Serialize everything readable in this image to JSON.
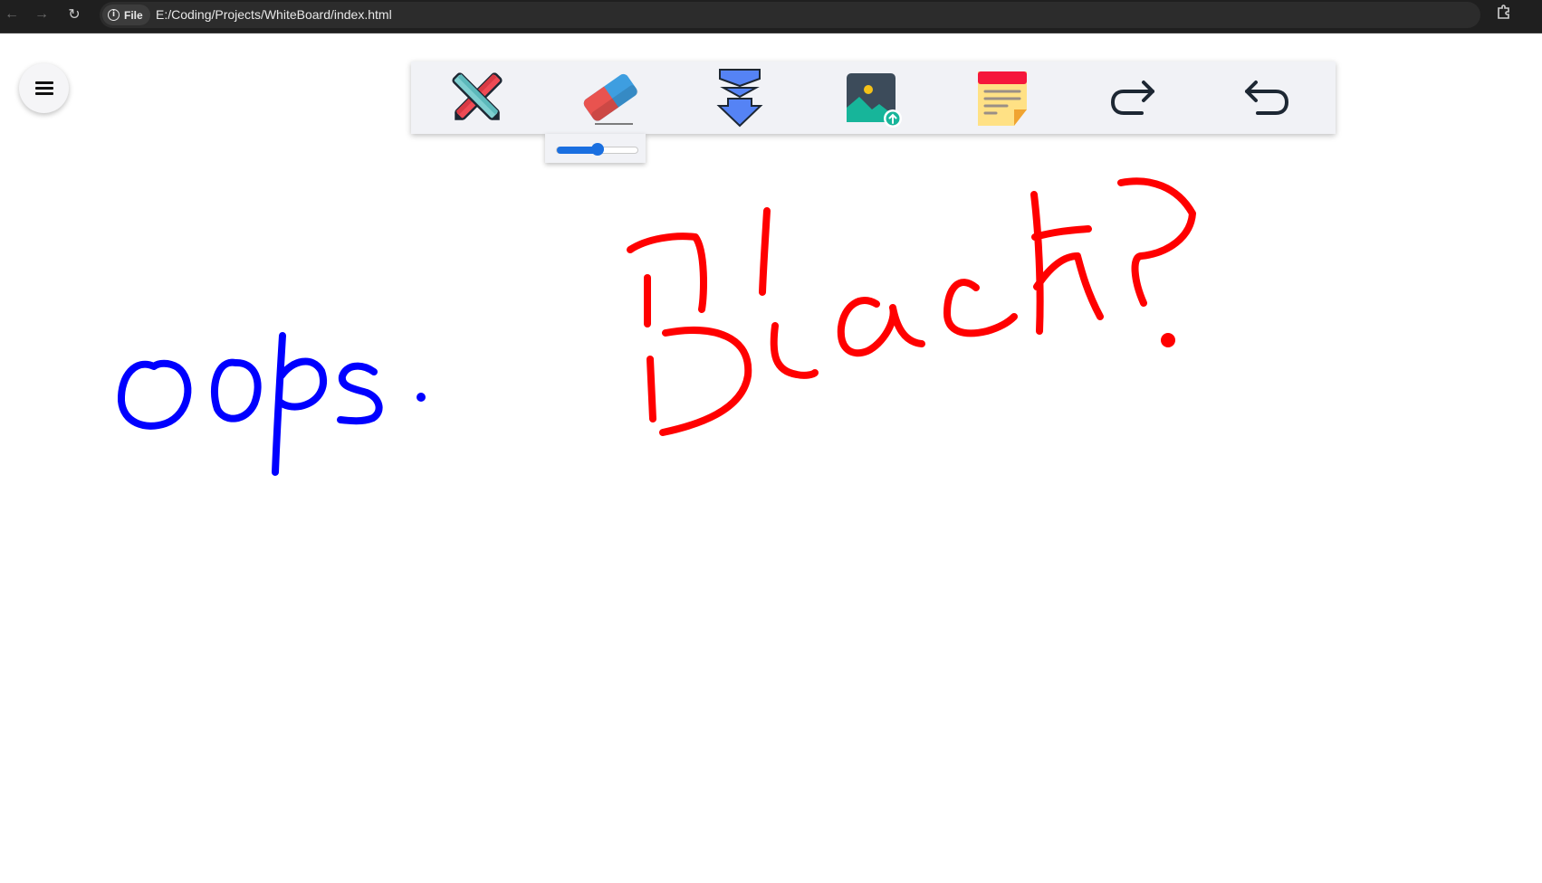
{
  "browser": {
    "back_icon": "←",
    "forward_icon": "→",
    "reload_icon": "↻",
    "site_chip_label": "File",
    "url": "E:/Coding/Projects/WhiteBoard/index.html",
    "bookmark_icon": "☆",
    "info_glyph": "i"
  },
  "toolbar": {
    "tools": [
      {
        "name": "pen-tool",
        "icon": "crossed-pencils-icon"
      },
      {
        "name": "eraser-tool",
        "icon": "eraser-icon"
      },
      {
        "name": "download-tool",
        "icon": "download-arrow-icon"
      },
      {
        "name": "upload-image-tool",
        "icon": "image-upload-icon"
      },
      {
        "name": "sticky-note-tool",
        "icon": "sticky-note-icon"
      },
      {
        "name": "redo-tool",
        "icon": "redo-arrow-icon"
      },
      {
        "name": "undo-tool",
        "icon": "undo-arrow-icon"
      }
    ]
  },
  "brush_size": {
    "fraction": 0.5,
    "accent_color": "#1a6fe0"
  },
  "canvas": {
    "background": "#ffffff",
    "stroke_colors": [
      "#0000ff",
      "#ff0000"
    ]
  }
}
